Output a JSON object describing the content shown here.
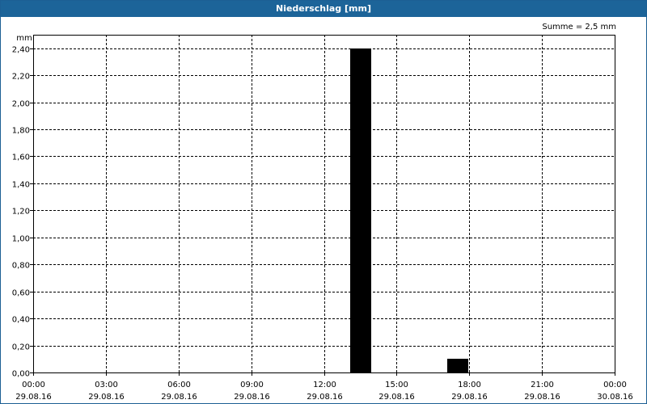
{
  "window": {
    "title": "Niederschlag [mm]"
  },
  "chart_data": {
    "type": "bar",
    "title": "Niederschlag [mm]",
    "ylabel": "mm",
    "sum_label": "Summe = 2,5 mm",
    "ylim": [
      0,
      2.5
    ],
    "y_ticks": [
      0,
      0.2,
      0.4,
      0.6,
      0.8,
      1.0,
      1.2,
      1.4,
      1.6,
      1.8,
      2.0,
      2.2,
      2.4
    ],
    "y_tick_labels": [
      "0,00",
      "0,20",
      "0,40",
      "0,60",
      "0,80",
      "1,00",
      "1,20",
      "1,40",
      "1,60",
      "1,80",
      "2,00",
      "2,20",
      "2,40"
    ],
    "x_range_hours": [
      0,
      24
    ],
    "x_ticks": [
      {
        "hour": 0,
        "time": "00:00",
        "date": "29.08.16"
      },
      {
        "hour": 3,
        "time": "03:00",
        "date": "29.08.16"
      },
      {
        "hour": 6,
        "time": "06:00",
        "date": "29.08.16"
      },
      {
        "hour": 9,
        "time": "09:00",
        "date": "29.08.16"
      },
      {
        "hour": 12,
        "time": "12:00",
        "date": "29.08.16"
      },
      {
        "hour": 15,
        "time": "15:00",
        "date": "29.08.16"
      },
      {
        "hour": 18,
        "time": "18:00",
        "date": "29.08.16"
      },
      {
        "hour": 21,
        "time": "21:00",
        "date": "29.08.16"
      },
      {
        "hour": 24,
        "time": "00:00",
        "date": "30.08.16"
      }
    ],
    "bars": [
      {
        "start_hour": 13,
        "end_hour": 14,
        "value": 2.4
      },
      {
        "start_hour": 17,
        "end_hour": 18,
        "value": 0.1
      }
    ],
    "grid": true,
    "bar_color": "#000000"
  }
}
